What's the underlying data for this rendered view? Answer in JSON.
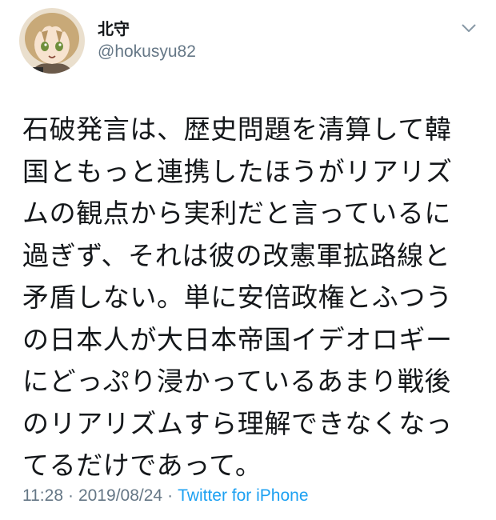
{
  "author": {
    "display_name": "北守",
    "handle": "@hokusyu82",
    "avatar_icon": "anime-avatar-icon",
    "menu_icon": "chevron-down-icon"
  },
  "tweet": {
    "lines": [
      "石破発言は、歴史問題を清算して韓",
      "国ともっと連携したほうがリアリズ",
      "ムの観点から実利だと言っているに",
      "過ぎず、それは彼の改憲軍拡路線と",
      "矛盾しない。単に安倍政権とふつう",
      "の日本人が大日本帝国イデオロギー",
      "にどっぷり浸かっているあまり戦後",
      "のリアリズムすら理解できなくなっ",
      "てるだけであって。"
    ]
  },
  "meta": {
    "time": "11:28",
    "separator": "·",
    "date": "2019/08/24",
    "source": "Twitter for iPhone"
  },
  "colors": {
    "text": "#14171a",
    "secondary": "#657786",
    "link": "#1da1f2"
  }
}
